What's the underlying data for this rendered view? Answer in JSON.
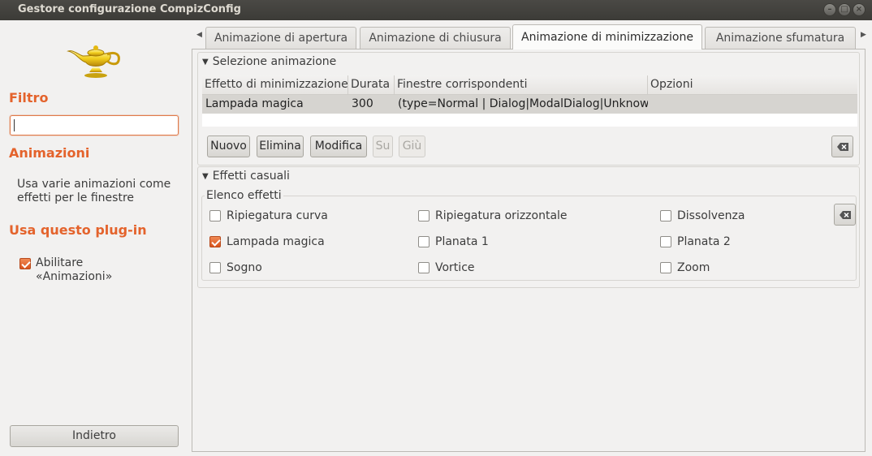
{
  "window": {
    "title": "Gestore configurazione CompizConfig"
  },
  "window_buttons": {
    "minimize": "–",
    "maximize": "□",
    "close": "×"
  },
  "sidebar": {
    "filter_heading": "Filtro",
    "filter_value": "",
    "plugin_heading": "Animazioni",
    "plugin_description": "Usa varie animazioni come effetti per le finestre",
    "use_heading": "Usa questo plug-in",
    "enable_label_line1": "Abilitare",
    "enable_label_line2": "«Animazioni»",
    "enable_checked": true,
    "back_label": "Indietro"
  },
  "tabs": [
    {
      "label": "Animazione di apertura",
      "active": false
    },
    {
      "label": "Animazione di chiusura",
      "active": false
    },
    {
      "label": "Animazione di minimizzazione",
      "active": true
    },
    {
      "label": "Animazione sfumatura",
      "active": false
    }
  ],
  "selection": {
    "title": "Selezione animazione",
    "columns": [
      "Effetto di minimizzazione",
      "Durata",
      "Finestre corrispondenti",
      "Opzioni"
    ],
    "rows": [
      [
        "Lampada magica",
        "300",
        "(type=Normal | Dialog|ModalDialog|Unknow)",
        ""
      ]
    ],
    "buttons": {
      "new": "Nuovo",
      "delete": "Elimina",
      "edit": "Modifica",
      "up": "Su",
      "down": "Giù"
    }
  },
  "random": {
    "title": "Effetti casuali",
    "list_label": "Elenco effetti",
    "options": [
      {
        "label": "Ripiegatura curva",
        "checked": false
      },
      {
        "label": "Ripiegatura orizzontale",
        "checked": false
      },
      {
        "label": "Dissolvenza",
        "checked": false
      },
      {
        "label": "Lampada magica",
        "checked": true
      },
      {
        "label": "Planata 1",
        "checked": false
      },
      {
        "label": "Planata 2",
        "checked": false
      },
      {
        "label": "Sogno",
        "checked": false
      },
      {
        "label": "Vortice",
        "checked": false
      },
      {
        "label": "Zoom",
        "checked": false
      }
    ]
  },
  "colors": {
    "accent": "#e4632c",
    "titlebar": "#3c3b37"
  }
}
